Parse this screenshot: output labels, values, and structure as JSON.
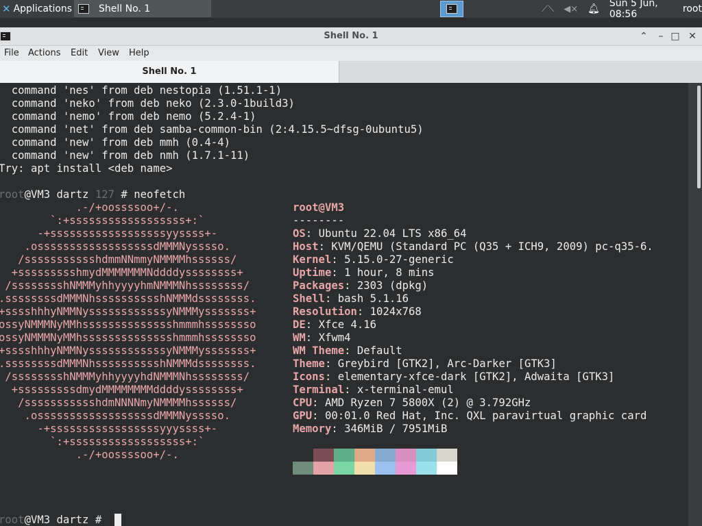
{
  "panel": {
    "apps_label": "Applications",
    "task_label": "Shell No. 1",
    "clock": "Sun  5 Jun, 08:56",
    "user": "root",
    "icons": [
      "applications-icon",
      "terminal-icon",
      "network-icon",
      "volume-muted-icon",
      "notification-bell-icon"
    ]
  },
  "window": {
    "title": "Shell No. 1",
    "menu": [
      "File",
      "Actions",
      "Edit",
      "View",
      "Help"
    ],
    "tab_label": "Shell No. 1"
  },
  "terminal": {
    "suggestions": [
      "  command 'nes' from deb nestopia (1.51.1-1)",
      "  command 'neko' from deb neko (2.3.0-1build3)",
      "  command 'nemo' from deb nemo (5.2.4-1)",
      "  command 'net' from deb samba-common-bin (2:4.15.5~dfsg-0ubuntu5)",
      "  command 'new' from deb mmh (0.4-4)",
      "  command 'new' from deb nmh (1.7.1-11)"
    ],
    "try_line": "Try: apt install <deb name>",
    "prompt1": {
      "user": "root",
      "host_path": "@VM3 dartz ",
      "code": "127",
      "hash": " # ",
      "cmd": "neofetch"
    },
    "prompt2": {
      "user": "root",
      "host_path": "@VM3 dartz # "
    },
    "art": [
      "            .-/+oossssoo+/-.",
      "        `:+ssssssssssssssssss+:`",
      "      -+ssssssssssssssssssyyssss+-",
      "    .ossssssssssssssssssdMMMNysssso.",
      "   /ssssssssssshdmmNNmmyNMMMMhssssss/",
      "  +ssssssssshmydMMMMMMMNddddyssssssss+",
      " /sssssssshNMMMyhhyyyyhmNMMMNhssssssss/",
      ".ssssssssdMMMNhsssssssssshNMMMdssssssss.",
      "+sssshhhyNMMNyssssssssssssyNMMMysssssss+",
      "ossyNMMMNyMMhsssssssssssssshmmmhssssssso",
      "ossyNMMMNyMMhsssssssssssssshmmmhssssssso",
      "+sssshhhyNMMNyssssssssssssyNMMMysssssss+",
      ".ssssssssdMMMNhsssssssssshNMMMdssssssss.",
      " /sssssssshNMMMyhhyyyyhdNMMMNhssssssss/",
      "  +sssssssssdmydMMMMMMMMddddyssssssss+",
      "   /ssssssssssshdmNNNNmyNMMMMhssssss/",
      "    .ossssssssssssssssssdMMMNysssso.",
      "      -+sssssssssssssssssyyyssss+-",
      "        `:+ssssssssssssssssss+:`",
      "            .-/+oossssoo+/-."
    ],
    "info_header": "root@VM3",
    "info_sep": "--------",
    "info": [
      {
        "key": "OS",
        "value": "Ubuntu 22.04 LTS x86_64"
      },
      {
        "key": "Host",
        "value": "KVM/QEMU (Standard PC (Q35 + ICH9, 2009) pc-q35-6."
      },
      {
        "key": "Kernel",
        "value": "5.15.0-27-generic"
      },
      {
        "key": "Uptime",
        "value": "1 hour, 8 mins"
      },
      {
        "key": "Packages",
        "value": "2303 (dpkg)"
      },
      {
        "key": "Shell",
        "value": "bash 5.1.16"
      },
      {
        "key": "Resolution",
        "value": "1024x768"
      },
      {
        "key": "DE",
        "value": "Xfce 4.16"
      },
      {
        "key": "WM",
        "value": "Xfwm4"
      },
      {
        "key": "WM Theme",
        "value": "Default"
      },
      {
        "key": "Theme",
        "value": "Greybird [GTK2], Arc-Darker [GTK3]"
      },
      {
        "key": "Icons",
        "value": "elementary-xfce-dark [GTK2], Adwaita [GTK3]"
      },
      {
        "key": "Terminal",
        "value": "x-terminal-emul"
      },
      {
        "key": "CPU",
        "value": "AMD Ryzen 7 5800X (2) @ 3.792GHz"
      },
      {
        "key": "GPU",
        "value": "00:01.0 Red Hat, Inc. QXL paravirtual graphic card"
      },
      {
        "key": "Memory",
        "value": "346MiB / 7951MiB"
      }
    ],
    "palette_top": [
      "#2b2d2e",
      "#7a4d55",
      "#5fae8a",
      "#dfa885",
      "#86a9cf",
      "#d68fc0",
      "#83c9d6",
      "#d6d6cc"
    ],
    "palette_bottom": [
      "#6f8c7a",
      "#e4a3a6",
      "#79d6a2",
      "#f1deab",
      "#9cc0ef",
      "#e79ad4",
      "#9ce0ea",
      "#ffffff"
    ],
    "colors": {
      "art": "#e7a6a9",
      "text": "#ececec",
      "dim": "#6b6e70",
      "background": "#2b2d2e"
    }
  }
}
